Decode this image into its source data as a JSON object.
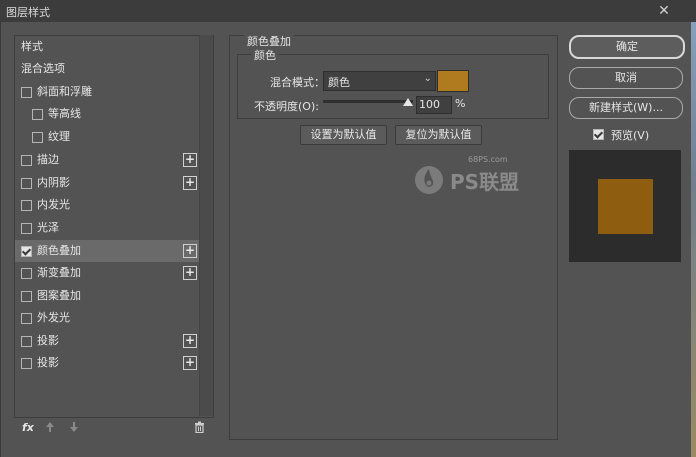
{
  "window": {
    "title": "图层样式",
    "close_glyph": "✕"
  },
  "left_panel": {
    "items": [
      {
        "label": "样式",
        "checkbox": false,
        "checked": false,
        "plus": false
      },
      {
        "label": "混合选项",
        "checkbox": false,
        "checked": false,
        "plus": false
      },
      {
        "label": "斜面和浮雕",
        "checkbox": true,
        "checked": false,
        "plus": false
      },
      {
        "label": "等高线",
        "checkbox": true,
        "checked": false,
        "plus": false,
        "indent": true
      },
      {
        "label": "纹理",
        "checkbox": true,
        "checked": false,
        "plus": false,
        "indent": true
      },
      {
        "label": "描边",
        "checkbox": true,
        "checked": false,
        "plus": true
      },
      {
        "label": "内阴影",
        "checkbox": true,
        "checked": false,
        "plus": true
      },
      {
        "label": "内发光",
        "checkbox": true,
        "checked": false,
        "plus": false
      },
      {
        "label": "光泽",
        "checkbox": true,
        "checked": false,
        "plus": false
      },
      {
        "label": "颜色叠加",
        "checkbox": true,
        "checked": true,
        "plus": true,
        "selected": true
      },
      {
        "label": "渐变叠加",
        "checkbox": true,
        "checked": false,
        "plus": true
      },
      {
        "label": "图案叠加",
        "checkbox": true,
        "checked": false,
        "plus": false
      },
      {
        "label": "外发光",
        "checkbox": true,
        "checked": false,
        "plus": false
      },
      {
        "label": "投影",
        "checkbox": true,
        "checked": false,
        "plus": true
      },
      {
        "label": "投影",
        "checkbox": true,
        "checked": false,
        "plus": true
      }
    ],
    "bottom": {
      "fx": "fx",
      "up_icon": "arrow-up-icon",
      "down_icon": "arrow-down-icon",
      "trash_icon": "trash-icon"
    }
  },
  "color_overlay": {
    "section_title": "颜色叠加",
    "group_title": "颜色",
    "blend_mode_label": "混合模式：",
    "blend_mode_value": "颜色",
    "overlay_color": "#b07a1f",
    "opacity_label": "不透明度(O):",
    "opacity_value": "100",
    "opacity_unit": "%",
    "set_default_label": "设置为默认值",
    "reset_default_label": "复位为默认值"
  },
  "right_panel": {
    "ok_label": "确定",
    "cancel_label": "取消",
    "new_style_label": "新建样式(W)...",
    "preview_label": "预览(V)",
    "preview_checked": true,
    "preview_color": "#8e5d10"
  },
  "watermark": {
    "site": "68PS.com",
    "brand": "PS联盟"
  }
}
